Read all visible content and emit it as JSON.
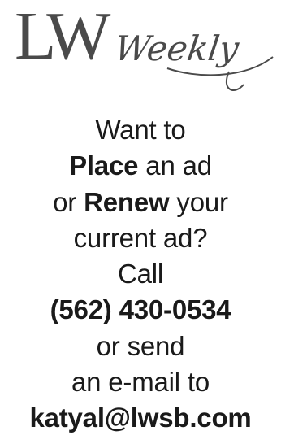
{
  "logo": {
    "mark": "LW",
    "word": "Weekly"
  },
  "ad": {
    "line1": "Want to",
    "line2_bold": "Place",
    "line2_rest": " an ad",
    "line3_prefix": "or ",
    "line3_bold": "Renew",
    "line3_rest": " your",
    "line4": "current ad?",
    "line5": "Call",
    "phone": "(562) 430-0534",
    "line7": "or send",
    "line8": "an e-mail to",
    "email": "katyal@lwsb.com"
  },
  "colors": {
    "text": "#1a1a1a",
    "logo": "#4a4a4a",
    "background": "#ffffff"
  }
}
